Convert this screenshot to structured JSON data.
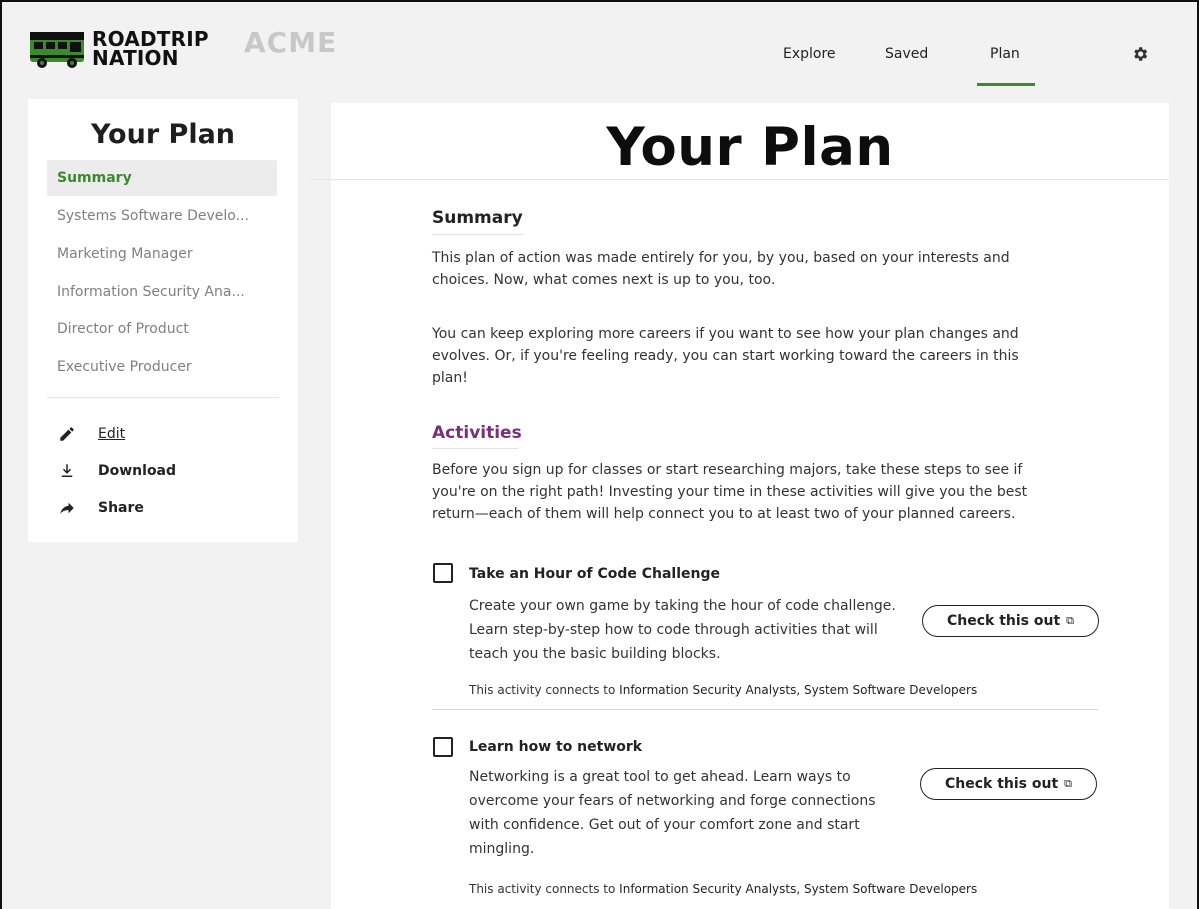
{
  "header": {
    "logo_line1": "ROADTRIP",
    "logo_line2": "NATION",
    "partner": "ACME",
    "nav": [
      {
        "label": "Explore"
      },
      {
        "label": "Saved"
      },
      {
        "label": "Plan",
        "active": true
      }
    ],
    "settings_icon": "gear-icon",
    "accent_color": "#3c8a2e"
  },
  "sidebar": {
    "title": "Your Plan",
    "items": [
      {
        "label": "Summary",
        "active": true
      },
      {
        "label": "Systems Software Develo..."
      },
      {
        "label": "Marketing Manager"
      },
      {
        "label": "Information Security Ana..."
      },
      {
        "label": "Director of Product"
      },
      {
        "label": "Executive Producer"
      }
    ],
    "actions": [
      {
        "label": "Edit",
        "icon": "pencil-icon"
      },
      {
        "label": "Download",
        "icon": "download-icon"
      },
      {
        "label": "Share",
        "icon": "share-arrow-icon"
      }
    ]
  },
  "main": {
    "title": "Your Plan",
    "summary": {
      "heading": "Summary",
      "p1": "This plan of action was made entirely for you, by you, based on your interests and choices. Now, what comes next is up to you, too.",
      "p2": "You can keep exploring more careers if you want to see how your plan changes and evolves. Or, if you're feeling ready, you can start working toward the careers in this plan!"
    },
    "activities": {
      "heading": "Activities",
      "heading_color": "#7a2e7c",
      "intro": "Before you sign up for classes or start researching majors, take these steps to see if you're on the right path! Investing your time in these activities will give you the best return—each of them will help connect you to at least two of your planned careers.",
      "items": [
        {
          "title": "Take an Hour of Code Challenge",
          "description": "Create your own game by taking the hour of code challenge. Learn step-by-step how to code through activities that will teach you the basic building blocks.",
          "cta": "Check this out",
          "connects_prefix": "This activity connects to",
          "connects": "Information Security Analysts, System Software Developers"
        },
        {
          "title": "Learn how to network",
          "description": "Networking is a great tool to get ahead. Learn ways to overcome your fears of networking and forge connections with confidence. Get out of your comfort zone and start mingling.",
          "cta": "Check this out",
          "connects_prefix": "This activity connects to",
          "connects": "Information Security Analysts, System Software Developers"
        }
      ]
    }
  }
}
